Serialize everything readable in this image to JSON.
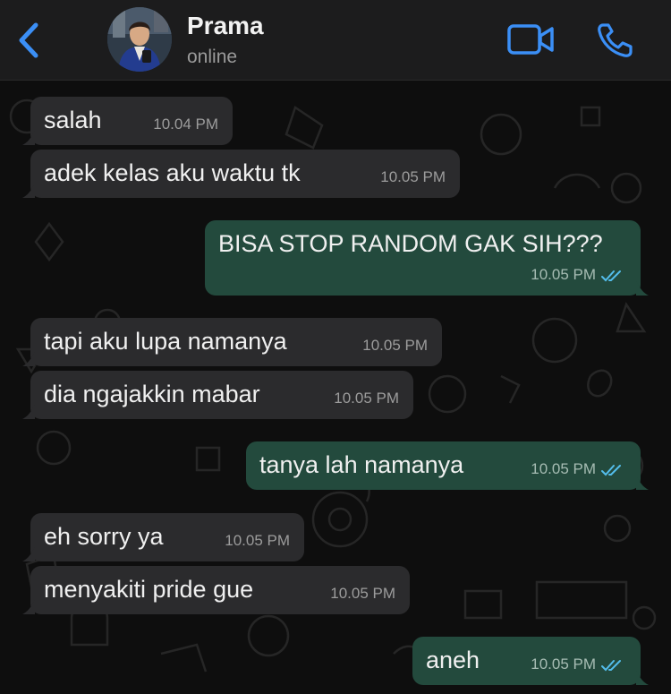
{
  "header": {
    "contact_name": "Prama",
    "contact_status": "online"
  },
  "colors": {
    "accent": "#3b8ff6",
    "incoming_bubble": "#2b2b2d",
    "outgoing_bubble": "#234a3d",
    "read_ticks": "#53bdeb"
  },
  "icons": {
    "back": "chevron-left-icon",
    "video": "video-camera-icon",
    "voice": "phone-icon",
    "read_receipt": "double-check-icon"
  },
  "messages": [
    {
      "direction": "incoming",
      "text": "salah",
      "time": "10.04 PM"
    },
    {
      "direction": "incoming",
      "text": "adek kelas aku waktu tk",
      "time": "10.05 PM"
    },
    {
      "direction": "outgoing",
      "text": "BISA STOP RANDOM GAK SIH???",
      "time": "10.05 PM",
      "read": true
    },
    {
      "direction": "incoming",
      "text": "tapi aku lupa namanya",
      "time": "10.05 PM"
    },
    {
      "direction": "incoming",
      "text": "dia ngajakkin mabar",
      "time": "10.05 PM"
    },
    {
      "direction": "outgoing",
      "text": "tanya lah namanya",
      "time": "10.05 PM",
      "read": true
    },
    {
      "direction": "incoming",
      "text": "eh sorry ya",
      "time": "10.05 PM"
    },
    {
      "direction": "incoming",
      "text": "menyakiti pride gue",
      "time": "10.05 PM"
    },
    {
      "direction": "outgoing",
      "text": "aneh",
      "time": "10.05 PM",
      "read": true
    }
  ]
}
